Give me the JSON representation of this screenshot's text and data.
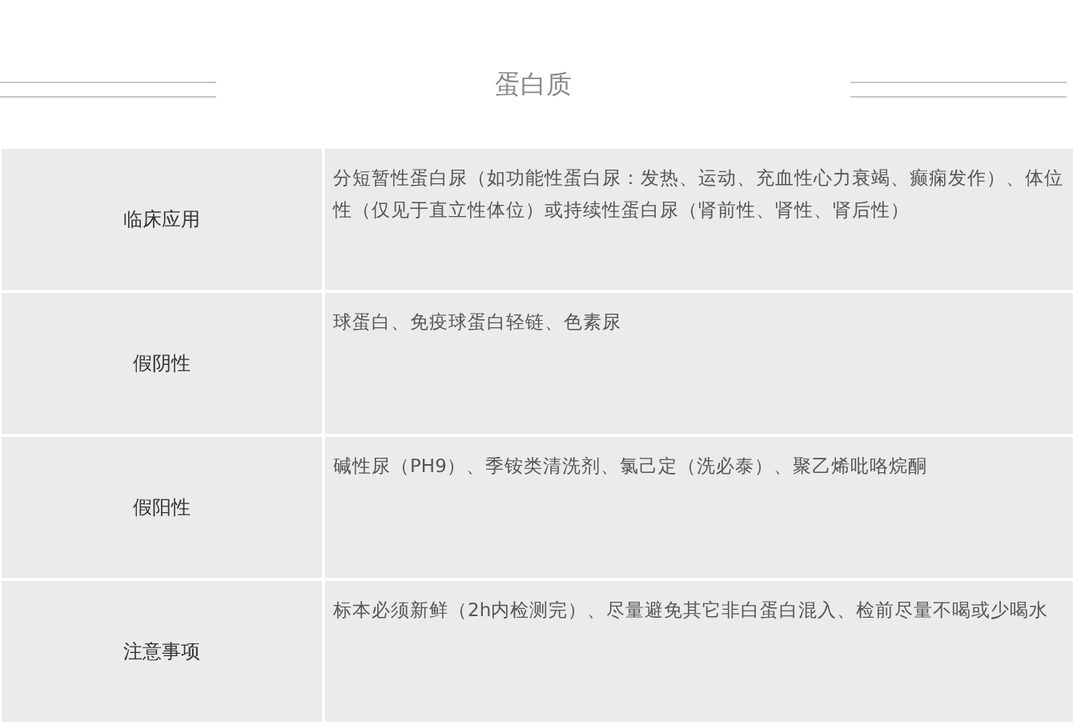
{
  "title": "蛋白质",
  "rows": [
    {
      "label": "临床应用",
      "text": "分短暂性蛋白尿（如功能性蛋白尿：发热、运动、充血性心力衰竭、癫痫发作）、体位性（仅见于直立性体位）或持续性蛋白尿（肾前性、肾性、肾后性）"
    },
    {
      "label": "假阴性",
      "text": "球蛋白、免疫球蛋白轻链、色素尿"
    },
    {
      "label": "假阳性",
      "text": "碱性尿（PH9）、季铵类清洗剂、氯己定（洗必泰）、聚乙烯吡咯烷酮"
    },
    {
      "label": "注意事项",
      "text": "标本必须新鲜（2h内检测完）、尽量避免其它非白蛋白混入、检前尽量不喝或少喝水"
    }
  ]
}
